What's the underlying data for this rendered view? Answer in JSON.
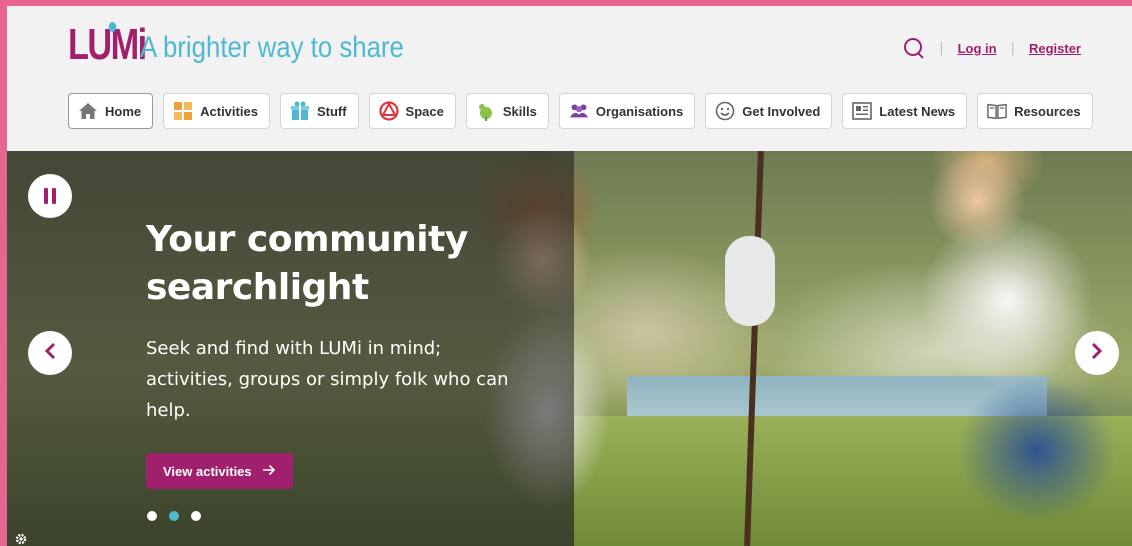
{
  "header": {
    "logo_text": "LUMi",
    "tagline": "A brighter way to share",
    "login": "Log in",
    "register": "Register",
    "separator": "|"
  },
  "nav": {
    "items": [
      {
        "label": "Home",
        "icon": "home-icon"
      },
      {
        "label": "Activities",
        "icon": "activities-icon"
      },
      {
        "label": "Stuff",
        "icon": "gift-icon"
      },
      {
        "label": "Space",
        "icon": "space-icon"
      },
      {
        "label": "Skills",
        "icon": "skills-icon"
      },
      {
        "label": "Organisations",
        "icon": "people-icon"
      },
      {
        "label": "Get Involved",
        "icon": "smiley-icon"
      },
      {
        "label": "Latest News",
        "icon": "news-icon"
      },
      {
        "label": "Resources",
        "icon": "book-icon"
      }
    ]
  },
  "hero": {
    "title": "Your community searchlight",
    "text": "Seek and find with LUMi in mind; activities, groups or simply folk who can help.",
    "cta_label": "View activities",
    "slide_count": 3,
    "active_slide": 2
  },
  "colors": {
    "brand": "#a1206e",
    "accent": "#4fb8d3",
    "frame": "#e8658f"
  }
}
